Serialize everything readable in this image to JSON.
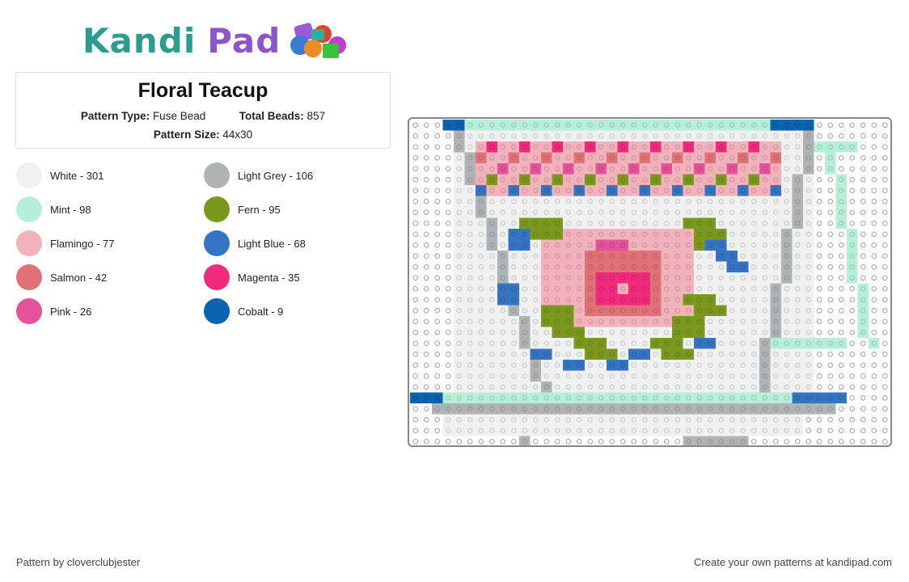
{
  "logo": {
    "word1": "Kandi",
    "word2": "Pad"
  },
  "pattern": {
    "title": "Floral Teacup",
    "type_label": "Pattern Type:",
    "type_value": "Fuse Bead",
    "total_label": "Total Beads:",
    "total_value": "857",
    "size_label": "Pattern Size:",
    "size_value": "44x30"
  },
  "legend": [
    {
      "label": "White - 301",
      "color": "#f0f0f0"
    },
    {
      "label": "Light Grey - 106",
      "color": "#b0b3b3"
    },
    {
      "label": "Mint - 98",
      "color": "#b6efd8"
    },
    {
      "label": "Fern - 95",
      "color": "#7a981e"
    },
    {
      "label": "Flamingo - 77",
      "color": "#f2b2bb"
    },
    {
      "label": "Light Blue - 68",
      "color": "#3574c3"
    },
    {
      "label": "Salmon - 42",
      "color": "#e07277"
    },
    {
      "label": "Magenta - 35",
      "color": "#ef2a7c"
    },
    {
      "label": "Pink - 26",
      "color": "#e5519a"
    },
    {
      "label": "Cobalt - 9",
      "color": "#0a63b0"
    }
  ],
  "footer": {
    "left": "Pattern by cloverclubjester",
    "right": "Create your own patterns at kandipad.com"
  }
}
